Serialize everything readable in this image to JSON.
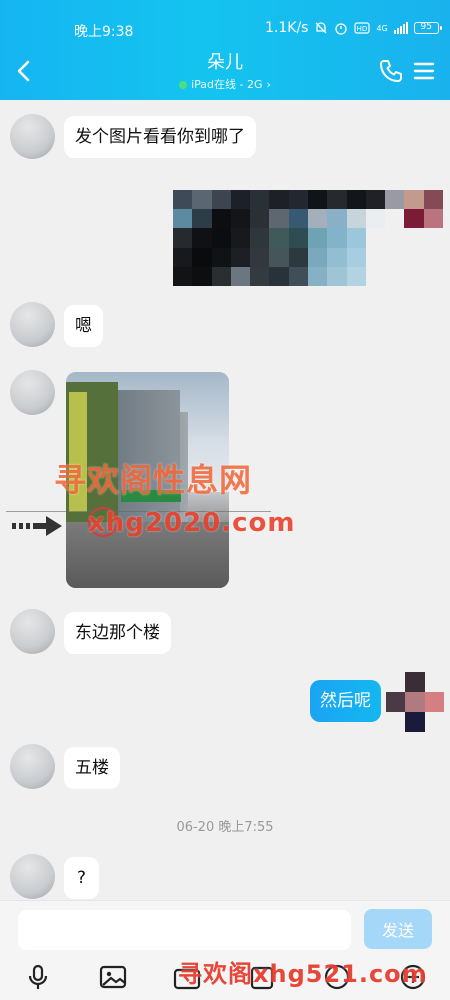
{
  "status_bar": {
    "time": "晚上9:38",
    "speed": "1.1K/s",
    "network": "4G",
    "battery": "95"
  },
  "header": {
    "contact_name": "朵儿",
    "contact_status": "iPad在线 - 2G",
    "status_chevron": "›"
  },
  "messages": [
    {
      "side": "left",
      "type": "text",
      "text": "发个图片看看你到哪了"
    },
    {
      "side": "right",
      "type": "image",
      "description": "mosaic-censored"
    },
    {
      "side": "left",
      "type": "text",
      "text": "嗯"
    },
    {
      "side": "left",
      "type": "image",
      "description": "street-photo"
    },
    {
      "side": "left",
      "type": "text",
      "text": "东边那个楼"
    },
    {
      "side": "right",
      "type": "text",
      "text": "然后呢"
    },
    {
      "side": "left",
      "type": "text",
      "text": "五楼"
    },
    {
      "side": "left",
      "type": "text",
      "text": "?"
    }
  ],
  "timestamp": "06-20 晚上7:55",
  "watermarks": {
    "line1": "寻欢阁性息网",
    "line2": "xhg2020.com",
    "line3": "寻欢阁xhg521.com"
  },
  "input": {
    "placeholder": "",
    "send_label": "发送"
  },
  "colors": {
    "header_bg": "#17b6f0",
    "my_bubble": "#1aa4f2",
    "send_disabled": "#a5d8f8",
    "chat_bg": "#f0f0f0"
  },
  "icons": [
    "back-icon",
    "phone-icon",
    "menu-icon",
    "mic-icon",
    "image-icon",
    "camera-icon",
    "file-icon",
    "emoji-icon",
    "plus-icon"
  ]
}
